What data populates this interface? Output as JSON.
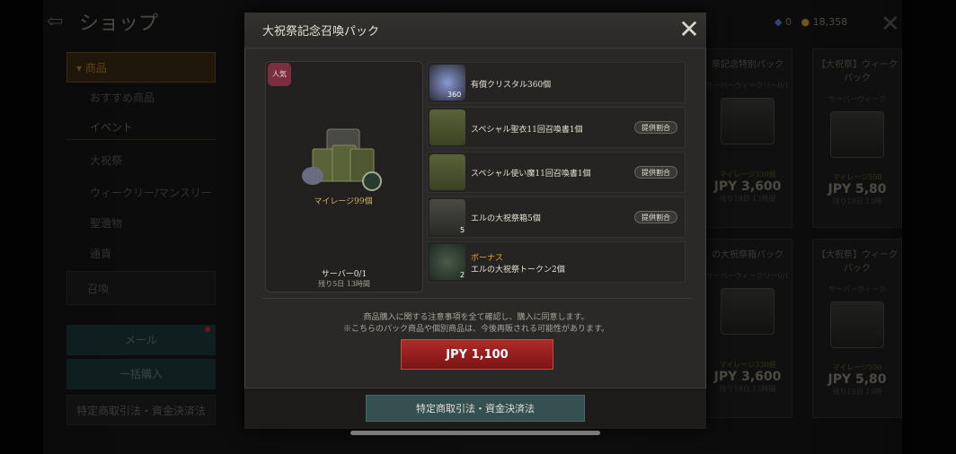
{
  "background": {
    "title": "ショップ",
    "sidebar": {
      "category": "商品",
      "items": [
        "おすすめ商品",
        "イベント",
        "大祝祭",
        "ウィークリー/マンスリー",
        "聖遺物",
        "通貨",
        "召喚"
      ],
      "mail_button": "メール",
      "bulk_buy_button": "一括購入",
      "trade_law_button": "特定商取引法・資金決済法"
    },
    "currency": {
      "crystal": "0",
      "gold": "18,358"
    },
    "cards": [
      {
        "title": "祭記念特別パック",
        "sub": "サーバーウィークリー0/1",
        "mileage": "マイレージ330個",
        "price": "JPY 3,600",
        "remaining": "残り19日 13時間"
      },
      {
        "title": "【大祝祭】ウィークパック",
        "sub": "サーバーウィーク",
        "mileage": "マイレージ550",
        "price": "JPY 5,80",
        "remaining": "残り19日 13時"
      },
      {
        "title": "の大祝祭箱パック",
        "sub": "サーバーウィークリー0/1",
        "mileage": "マイレージ330個",
        "price": "JPY 3,600",
        "remaining": "残り19日 13時間"
      },
      {
        "title": "【大祝祭】ウィークパック",
        "sub": "サーバーウィーク",
        "mileage": "マイレージ550",
        "price": "JPY 5,80",
        "remaining": "残り19日 13時"
      }
    ]
  },
  "modal": {
    "title": "大祝祭記念召喚パック",
    "badge": "人気",
    "mileage": "マイレージ99個",
    "server_limit": "サーバー0/1",
    "time_left": "残り5日 13時間",
    "items": [
      {
        "name": "有償クリスタル360個",
        "count": "360",
        "has_rate": false,
        "bonus": ""
      },
      {
        "name": "スペシャル聖衣11回召喚書1個",
        "count": "",
        "has_rate": true,
        "bonus": ""
      },
      {
        "name": "スペシャル使い魔11回召喚書1個",
        "count": "",
        "has_rate": true,
        "bonus": ""
      },
      {
        "name": "エルの大祝祭箱5個",
        "count": "5",
        "has_rate": true,
        "bonus": ""
      },
      {
        "name": "エルの大祝祭トークン2個",
        "count": "2",
        "has_rate": false,
        "bonus": "ボーナス"
      }
    ],
    "rate_label": "提供割合",
    "notice_line1": "商品購入に関する注意事項を全て確認し、購入に同意します。",
    "notice_line2": "※こちらのパック商品や個別商品は、今後再販される可能性があります。",
    "buy_button": "JPY 1,100",
    "trade_law_button": "特定商取引法・資金決済法"
  },
  "colors": {
    "accent_red": "#b02a2a",
    "gold_text": "#d0b060",
    "bonus_orange": "#e8a040",
    "teal_button": "#355050"
  }
}
